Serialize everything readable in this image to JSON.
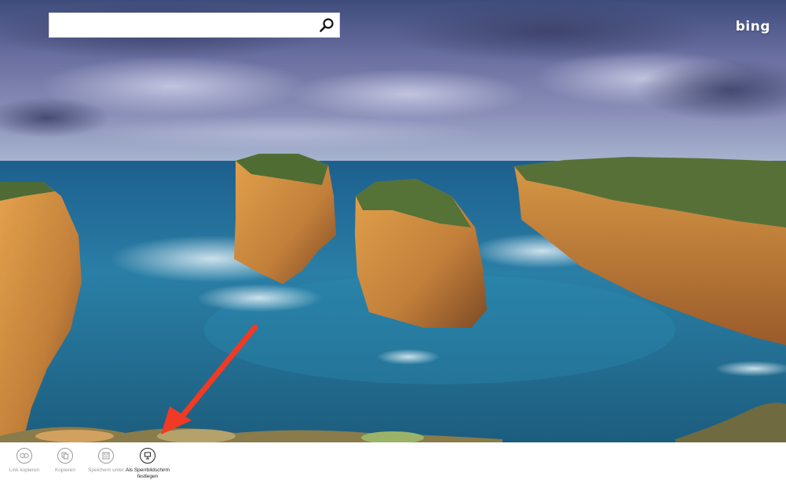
{
  "search": {
    "value": "",
    "placeholder": ""
  },
  "brand": {
    "logo_text": "bing"
  },
  "appbar": {
    "commands": [
      {
        "label": "Link kopieren",
        "icon": "link-icon",
        "active": false
      },
      {
        "label": "Kopieren",
        "icon": "copy-icon",
        "active": false
      },
      {
        "label": "Speichern unter",
        "icon": "save-icon",
        "active": false
      },
      {
        "label": "Als Sperrbildschirm festlegen",
        "icon": "set-lockscreen-icon",
        "active": true
      }
    ]
  },
  "annotation": {
    "arrow_color": "#f03a24"
  },
  "colors": {
    "sky_top": "#3f4d7a",
    "ocean": "#1f6a8c",
    "cliff": "#c98a3a",
    "appbar_bg": "#ffffff"
  }
}
